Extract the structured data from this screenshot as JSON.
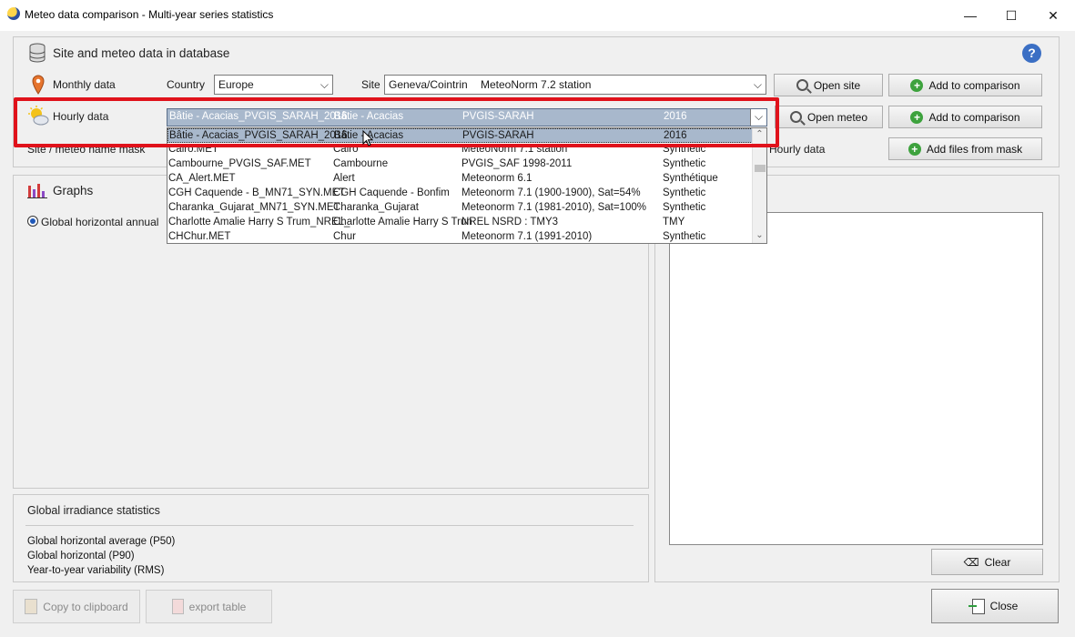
{
  "window": {
    "title": "Meteo data comparison - Multi-year series statistics",
    "min": "—",
    "max": "☐",
    "close": "✕"
  },
  "site_section": {
    "title": "Site and meteo data in database",
    "help": "?",
    "monthly_label": "Monthly data",
    "country_label": "Country",
    "country_value": "Europe",
    "site_label": "Site",
    "site_value": "Geneva/Cointrin",
    "site_source": "MeteoNorm 7.2 station",
    "open_site": "Open site",
    "add_comparison_1": "Add to comparison",
    "hourly_label": "Hourly data",
    "hourly_selected": {
      "file": "Bâtie - Acacias_PVGIS_SARAH_2016.",
      "site": "Bâtie - Acacias",
      "source": "PVGIS-SARAH",
      "year": "2016"
    },
    "open_meteo": "Open meteo",
    "add_comparison_2": "Add to comparison",
    "mask_label": "Site / meteo name mask",
    "hourly_data_text": "Hourly data",
    "add_files_mask": "Add files from mask"
  },
  "dropdown": {
    "rows": [
      {
        "file": "Bâtie - Acacias_PVGIS_SARAH_2016.",
        "site": "Bâtie - Acacias",
        "source": "PVGIS-SARAH",
        "type": "2016"
      },
      {
        "file": "Cairo.MET",
        "site": "Cairo",
        "source": "MeteoNorm 7.1 station",
        "type": "Synthetic"
      },
      {
        "file": "Cambourne_PVGIS_SAF.MET",
        "site": "Cambourne",
        "source": "PVGIS_SAF 1998-2011",
        "type": "Synthetic"
      },
      {
        "file": "CA_Alert.MET",
        "site": "Alert",
        "source": "Meteonorm 6.1",
        "type": "Synthétique"
      },
      {
        "file": "CGH Caquende - B_MN71_SYN.MET",
        "site": "CGH Caquende - Bonfim",
        "source": "Meteonorm 7.1 (1900-1900), Sat=54%",
        "type": "Synthetic"
      },
      {
        "file": "Charanka_Gujarat_MN71_SYN.MET",
        "site": "Charanka_Gujarat",
        "source": "Meteonorm 7.1 (1981-2010), Sat=100%",
        "type": "Synthetic"
      },
      {
        "file": "Charlotte Amalie Harry S Trum_NREL_",
        "site": "Charlotte Amalie Harry S Trun",
        "source": "NREL NSRD : TMY3",
        "type": "TMY"
      },
      {
        "file": "CHChur.MET",
        "site": "Chur",
        "source": "Meteonorm 7.1 (1991-2010)",
        "type": "Synthetic"
      }
    ]
  },
  "graphs": {
    "title": "Graphs",
    "radio_label": "Global horizontal annual"
  },
  "right_panel": {
    "clear": "Clear"
  },
  "stats": {
    "title": "Global irradiance statistics",
    "rows": [
      "Global horizontal average (P50)",
      "Global horizontal (P90)",
      "Year-to-year variability (RMS)"
    ]
  },
  "footer": {
    "copy": "Copy to clipboard",
    "export": "export table",
    "close": "Close"
  },
  "colors": {
    "highlight": "#e0121b",
    "accent": "#3da23d",
    "selection": "#a8b8cc"
  }
}
